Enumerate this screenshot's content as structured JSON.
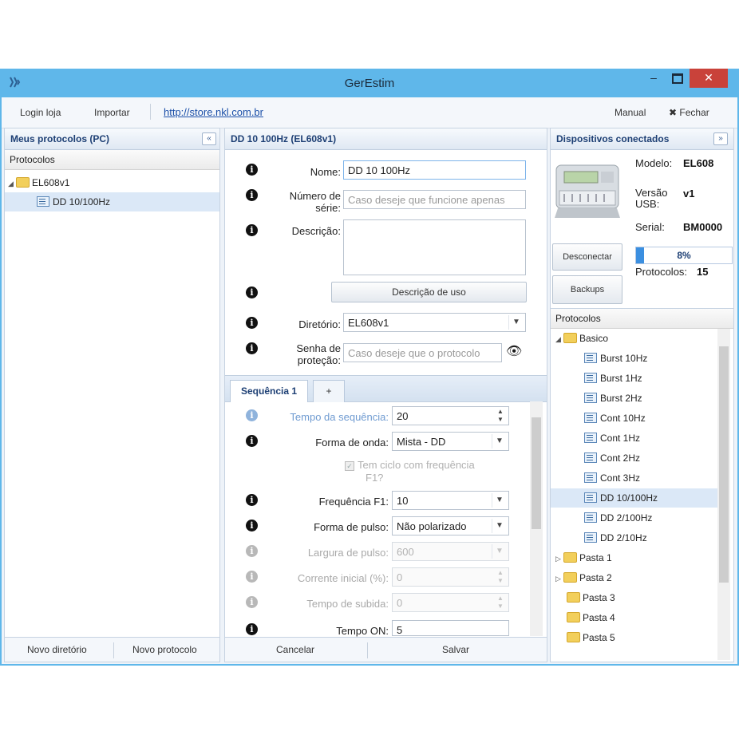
{
  "window": {
    "title": "GerEstim",
    "close_glyph": "✕",
    "min_glyph": "–"
  },
  "toolbar": {
    "login": "Login loja",
    "import": "Importar",
    "link": "http://store.nkl.com.br",
    "manual": "Manual",
    "close": "Fechar",
    "close_glyph": "✖"
  },
  "left": {
    "header": "Meus protocolos (PC)",
    "collapse_glyph": "«",
    "subheader": "Protocolos",
    "tree": [
      {
        "label": "EL608v1",
        "type": "folder",
        "expanded": true
      },
      {
        "label": "DD 10/100Hz",
        "type": "protocol",
        "selected": true
      }
    ],
    "footer": {
      "new_dir": "Novo diretório",
      "new_proto": "Novo protocolo"
    }
  },
  "center": {
    "header": "DD 10 100Hz (EL608v1)",
    "fields": {
      "name_label": "Nome:",
      "name_value": "DD 10 100Hz",
      "serial_label_1": "Número de",
      "serial_label_2": "série:",
      "serial_placeholder": "Caso deseje que funcione apenas",
      "desc_label": "Descrição:",
      "desc_use_button": "Descrição de uso",
      "dir_label": "Diretório:",
      "dir_value": "EL608v1",
      "pwd_label_1": "Senha de",
      "pwd_label_2": "proteção:",
      "pwd_placeholder": "Caso deseje que o protocolo",
      "eye_glyph": "👁"
    },
    "tabs": {
      "active": "Sequência 1",
      "add": "+"
    },
    "seq": {
      "duration_label": "Tempo da sequência:",
      "duration_value": "20",
      "wave_label": "Forma de onda:",
      "wave_value": "Mista - DD",
      "checkbox_label_1": "Tem ciclo com frequência",
      "checkbox_label_2": "F1?",
      "checkbox_glyph": "✓",
      "freq_label": "Frequência F1:",
      "freq_value": "10",
      "pulse_label": "Forma de pulso:",
      "pulse_value": "Não polarizado",
      "width_label": "Largura de pulso:",
      "width_value": "600",
      "current_label": "Corrente inicial (%):",
      "current_value": "0",
      "rise_label": "Tempo de subida:",
      "rise_value": "0",
      "on_label": "Tempo ON:",
      "on_value": "5"
    },
    "footer": {
      "cancel": "Cancelar",
      "save": "Salvar"
    }
  },
  "right": {
    "header": "Dispositivos conectados",
    "collapse_glyph": "»",
    "device": {
      "model_label": "Modelo:",
      "model_value": "EL608",
      "version_label_1": "Versão",
      "version_label_2": "USB:",
      "version_value": "v1",
      "serial_label": "Serial:",
      "serial_value": "BM0000",
      "disconnect": "Desconectar",
      "backups": "Backups",
      "progress_text": "8%",
      "progress": 0.08,
      "protocols_label": "Protocolos:",
      "protocols_value": "15"
    },
    "subheader": "Protocolos",
    "tree": [
      {
        "label": "Basico",
        "type": "folder",
        "expanded": true
      },
      {
        "label": "Burst 10Hz",
        "type": "protocol"
      },
      {
        "label": "Burst 1Hz",
        "type": "protocol"
      },
      {
        "label": "Burst 2Hz",
        "type": "protocol"
      },
      {
        "label": "Cont 10Hz",
        "type": "protocol"
      },
      {
        "label": "Cont 1Hz",
        "type": "protocol"
      },
      {
        "label": "Cont 2Hz",
        "type": "protocol"
      },
      {
        "label": "Cont 3Hz",
        "type": "protocol"
      },
      {
        "label": "DD 10/100Hz",
        "type": "protocol",
        "selected": true
      },
      {
        "label": "DD 2/100Hz",
        "type": "protocol"
      },
      {
        "label": "DD 2/10Hz",
        "type": "protocol"
      },
      {
        "label": "Pasta 1",
        "type": "folder",
        "collapsed": true
      },
      {
        "label": "Pasta 2",
        "type": "folder",
        "collapsed": true
      },
      {
        "label": "Pasta 3",
        "type": "folder"
      },
      {
        "label": "Pasta 4",
        "type": "folder"
      },
      {
        "label": "Pasta 5",
        "type": "folder"
      }
    ]
  },
  "icons": {
    "info": "i",
    "dropdown": "▼",
    "spin_up": "▲",
    "spin_down": "▼",
    "tree_expanded": "◢",
    "tree_collapsed": "▷"
  },
  "colors": {
    "titlebar": "#5fb7ea",
    "close": "#c9423a",
    "header_text": "#1d3f74",
    "link": "#1b4fa8",
    "selection": "#dbe8f7",
    "progress": "#3b8fe0"
  }
}
